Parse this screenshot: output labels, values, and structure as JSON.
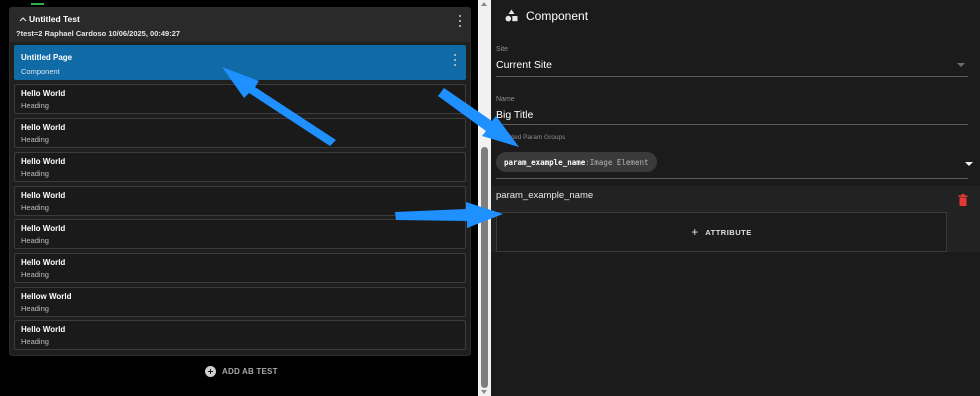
{
  "left": {
    "test": {
      "title": "Untitled Test",
      "subtitle": "?test=2 Raphael Cardoso 10/06/2025, 00:49:27"
    },
    "pages": [
      {
        "title": "Untitled Page",
        "subtitle": "Component",
        "selected": true
      },
      {
        "title": "Hello World",
        "subtitle": "Heading"
      },
      {
        "title": "Hello World",
        "subtitle": "Heading"
      },
      {
        "title": "Hello World",
        "subtitle": "Heading"
      },
      {
        "title": "Hello World",
        "subtitle": "Heading"
      },
      {
        "title": "Hello World",
        "subtitle": "Heading"
      },
      {
        "title": "Hello World",
        "subtitle": "Heading"
      },
      {
        "title": "Hellow World",
        "subtitle": "Heading"
      },
      {
        "title": "Hello World",
        "subtitle": "Heading"
      }
    ],
    "add_ab_label": "ADD AB TEST"
  },
  "right": {
    "title": "Component",
    "site": {
      "label": "Site",
      "value": "Current Site"
    },
    "name": {
      "label": "Name",
      "value": "Big Title"
    },
    "param_groups": {
      "label": "Selected Param Groups",
      "chip_key": "param_example_name",
      "chip_sep": ":",
      "chip_value": "Image Element"
    },
    "param": {
      "name": "param_example_name",
      "attribute_button": "ATTRIBUTE"
    }
  },
  "colors": {
    "selected": "#0f6aa6",
    "arrow": "#1e90ff",
    "delete": "#e53935"
  }
}
